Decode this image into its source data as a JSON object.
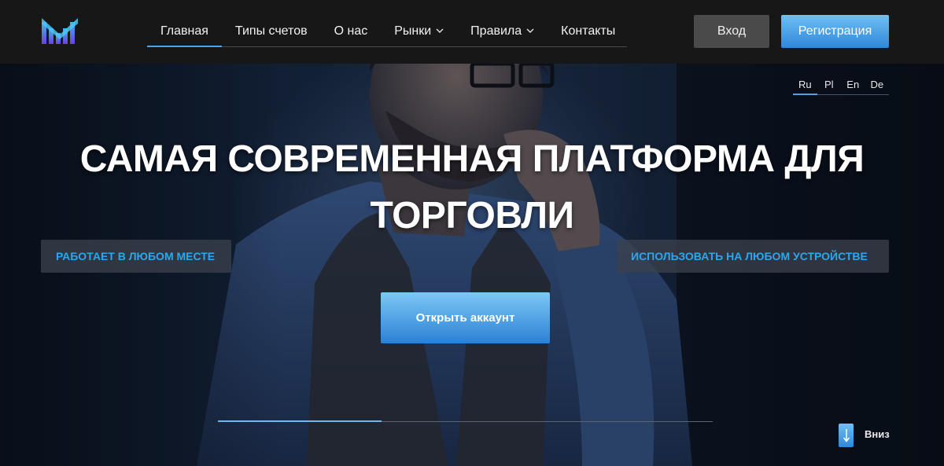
{
  "header": {
    "nav": [
      {
        "label": "Главная",
        "active": true,
        "has_dropdown": false
      },
      {
        "label": "Типы счетов",
        "active": false,
        "has_dropdown": false
      },
      {
        "label": "О нас",
        "active": false,
        "has_dropdown": false
      },
      {
        "label": "Рынки",
        "active": false,
        "has_dropdown": true
      },
      {
        "label": "Правила",
        "active": false,
        "has_dropdown": true
      },
      {
        "label": "Контакты",
        "active": false,
        "has_dropdown": false
      }
    ],
    "login_label": "Вход",
    "register_label": "Регистрация"
  },
  "hero": {
    "languages": [
      {
        "code": "Ru",
        "active": true
      },
      {
        "code": "Pl",
        "active": false
      },
      {
        "code": "En",
        "active": false
      },
      {
        "code": "De",
        "active": false
      }
    ],
    "title": "САМАЯ СОВРЕМЕННАЯ ПЛАТФОРМА ДЛЯ ТОРГОВЛИ",
    "badge_left": "РАБОТАЕТ В ЛЮБОМ МЕСТЕ",
    "badge_right": "ИСПОЛЬЗОВАТЬ НА ЛЮБОМ УСТРОЙСТВЕ",
    "cta_label": "Открыть аккаунт",
    "slider_progress": 0.33,
    "scroll_down_label": "Вниз"
  },
  "colors": {
    "accent": "#4ea3e6",
    "badge_text": "#2aa8ef",
    "header_bg": "#171717",
    "login_bg": "#4a4a4a"
  },
  "icons": {
    "logo": "brand-logo-icon",
    "dropdown": "chevron-down-icon",
    "scroll_down": "arrow-down-icon"
  }
}
